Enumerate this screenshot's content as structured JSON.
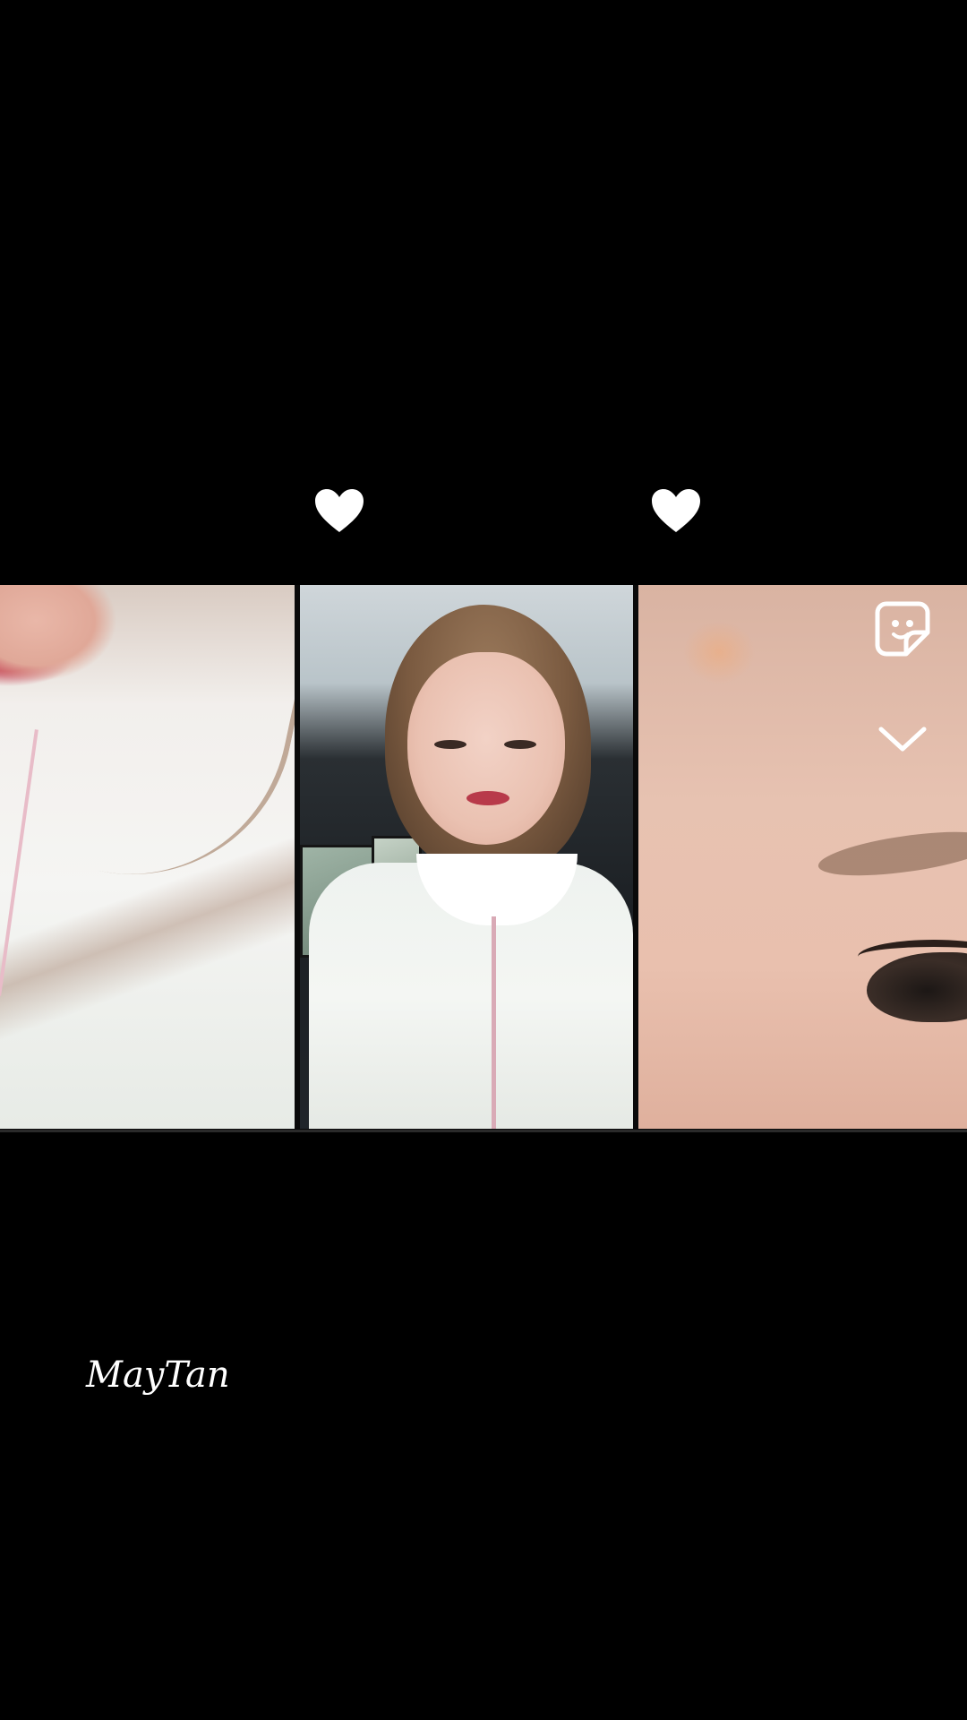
{
  "watermark": {
    "text": "MayTan"
  },
  "icons": {
    "sticker": "sticker-icon",
    "collapse": "chevron-down-icon",
    "like": "heart-icon"
  },
  "panels": [
    {
      "name": "left",
      "description_icon": "video-thumbnail"
    },
    {
      "name": "center",
      "description_icon": "video-thumbnail"
    },
    {
      "name": "right",
      "description_icon": "video-thumbnail"
    }
  ],
  "colors": {
    "background": "#000000",
    "icon": "#ffffff"
  }
}
